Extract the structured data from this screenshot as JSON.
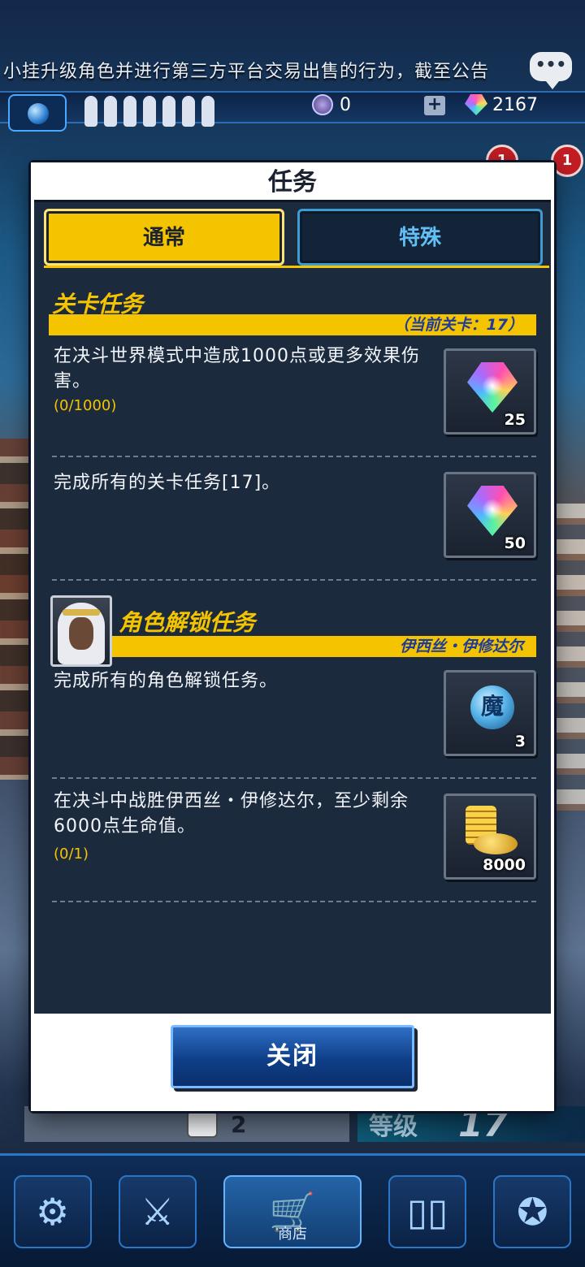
{
  "background": {
    "marquee_text": "小挂升级角色并进行第三方平台交易出售的行为，截至公告",
    "currency_a": "0",
    "currency_gems": "2167",
    "badges": [
      "1",
      "1"
    ],
    "dice_value": "2",
    "level_label": "等级",
    "level_value": "17",
    "nav_items": [
      {
        "name": "duelist",
        "label": ""
      },
      {
        "name": "duel",
        "label": ""
      },
      {
        "name": "shop",
        "label": "商店"
      },
      {
        "name": "cards",
        "label": ""
      },
      {
        "name": "settings",
        "label": ""
      }
    ]
  },
  "modal": {
    "title": "任务",
    "tabs": [
      {
        "label": "通常",
        "active": true
      },
      {
        "label": "特殊",
        "active": false
      }
    ],
    "stage_section": {
      "title": "关卡任务",
      "subtitle": "（当前关卡：17）",
      "missions": [
        {
          "text": "在决斗世界模式中造成1000点或更多效果伤害。",
          "progress": "(0/1000)",
          "reward_icon": "gem-icon",
          "reward_qty": "25"
        },
        {
          "text": "完成所有的关卡任务[17]。",
          "progress": "",
          "reward_icon": "gem-icon",
          "reward_qty": "50"
        }
      ]
    },
    "character_section": {
      "title": "角色解锁任务",
      "character_name": "伊西丝・伊修达尔",
      "missions": [
        {
          "text": "完成所有的角色解锁任务。",
          "progress": "",
          "reward_icon": "magic-orb-icon",
          "reward_glyph": "魔",
          "reward_qty": "3"
        },
        {
          "text": "在决斗中战胜伊西丝・伊修达尔，至少剩余6000点生命值。",
          "progress": "(0/1)",
          "reward_icon": "gold-coins-icon",
          "reward_qty": "8000"
        }
      ]
    },
    "close_label": "关闭"
  },
  "colors": {
    "accent_yellow": "#f5c400",
    "panel_bg": "#1c2a3d",
    "special_tab_text": "#62bff5",
    "close_button": "#0f3e88"
  }
}
